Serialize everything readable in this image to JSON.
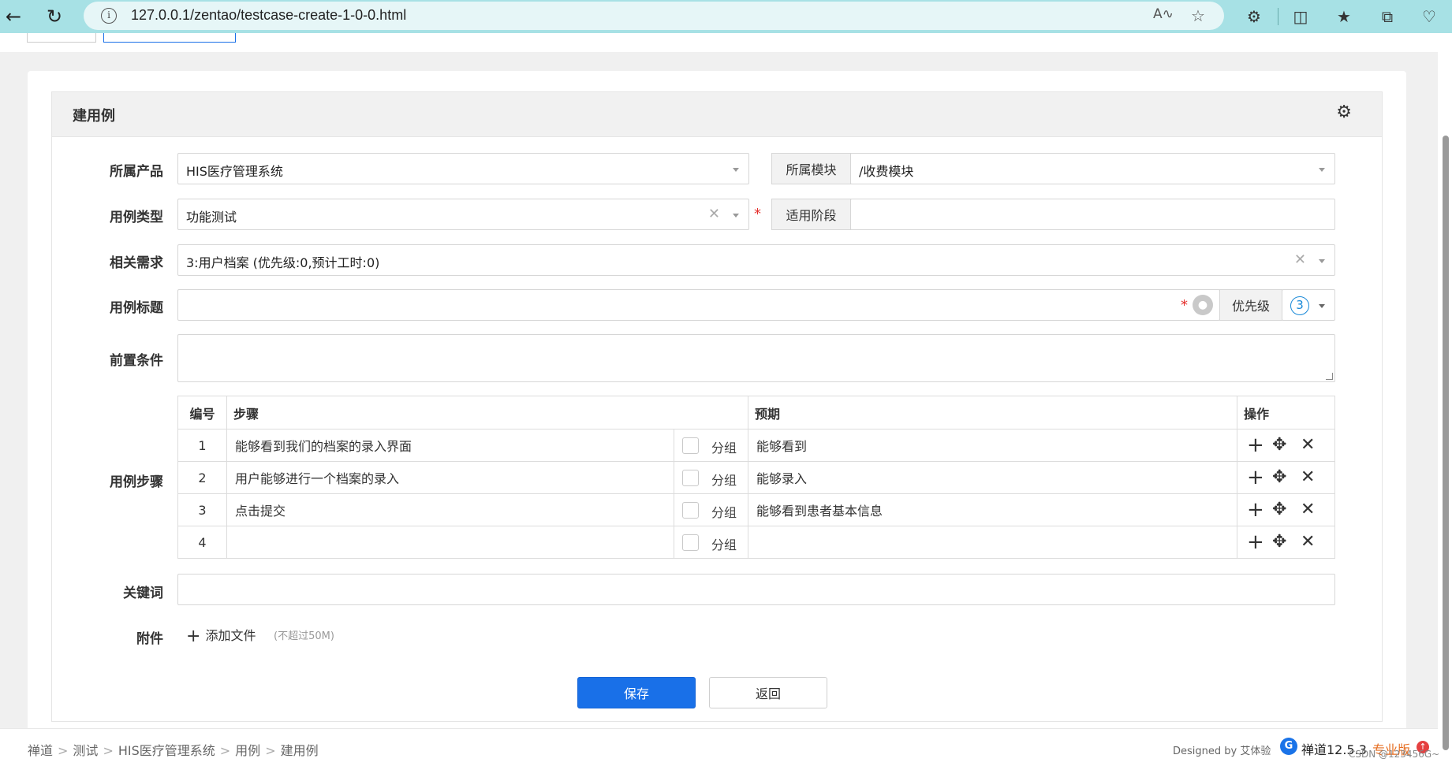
{
  "browser": {
    "url": "127.0.0.1/zentao/testcase-create-1-0-0.html"
  },
  "page": {
    "title": "建用例"
  },
  "form": {
    "product_label": "所属产品",
    "product_value": "HIS医疗管理系统",
    "module_label": "所属模块",
    "module_value": "/收费模块",
    "type_label": "用例类型",
    "type_value": "功能测试",
    "stage_label": "适用阶段",
    "story_label": "相关需求",
    "story_value": "3:用户档案 (优先级:0,预计工时:0)",
    "title_label": "用例标题",
    "priority_label": "优先级",
    "priority_value": "3",
    "precondition_label": "前置条件",
    "steps_label": "用例步骤",
    "keywords_label": "关键词",
    "files_label": "附件",
    "add_file": "添加文件",
    "file_limit": "(不超过50M)",
    "save": "保存",
    "back": "返回"
  },
  "steps_table": {
    "headers": [
      "编号",
      "步骤",
      "预期",
      "操作"
    ],
    "group_label": "分组",
    "rows": [
      {
        "num": "1",
        "step": "能够看到我们的档案的录入界面",
        "expect": "能够看到"
      },
      {
        "num": "2",
        "step": "用户能够进行一个档案的录入",
        "expect": "能够录入"
      },
      {
        "num": "3",
        "step": "点击提交",
        "expect": "能够看到患者基本信息"
      },
      {
        "num": "4",
        "step": "",
        "expect": ""
      }
    ]
  },
  "footer": {
    "breadcrumb": [
      "禅道",
      "测试",
      "HIS医疗管理系统",
      "用例",
      "建用例"
    ],
    "designed_by": "Designed by 艾体验",
    "version": "禅道12.5.3",
    "edition": "专业版",
    "watermark": "CSDN @123456G~"
  },
  "colors": {
    "accent": "#1970e8",
    "browser_bar": "#a7e1e5",
    "required": "#e5302d"
  }
}
